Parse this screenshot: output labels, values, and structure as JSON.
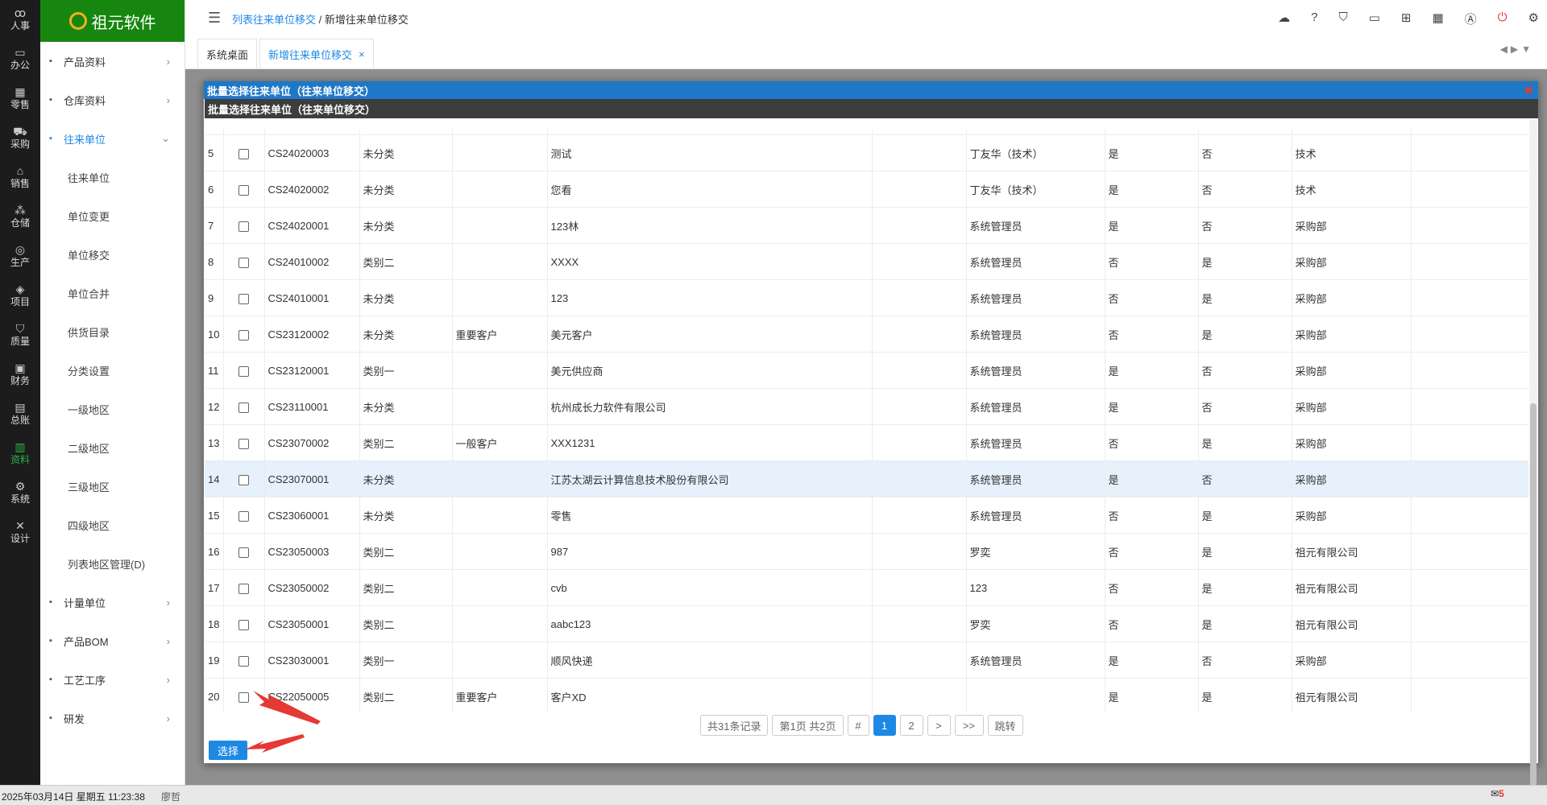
{
  "sidebar_icons": [
    {
      "label": "人事",
      "icon": "people-icon"
    },
    {
      "label": "办公",
      "icon": "monitor-icon"
    },
    {
      "label": "零售",
      "icon": "store-icon"
    },
    {
      "label": "采购",
      "icon": "truck-icon"
    },
    {
      "label": "销售",
      "icon": "cashier-icon"
    },
    {
      "label": "仓储",
      "icon": "boxes-icon"
    },
    {
      "label": "生产",
      "icon": "fingerprint-icon"
    },
    {
      "label": "项目",
      "icon": "layers-icon"
    },
    {
      "label": "质量",
      "icon": "shield-icon"
    },
    {
      "label": "财务",
      "icon": "finance-icon"
    },
    {
      "label": "总账",
      "icon": "ledger-icon"
    },
    {
      "label": "资料",
      "icon": "document-icon"
    },
    {
      "label": "系统",
      "icon": "gear-icon"
    },
    {
      "label": "设计",
      "icon": "tools-icon"
    }
  ],
  "active_icon": "资料",
  "logo_text": "祖元软件",
  "menu": {
    "before": [
      {
        "label": "产品资料",
        "icon": "folder-icon"
      },
      {
        "label": "仓库资料",
        "icon": "warehouse-icon"
      }
    ],
    "open": {
      "label": "往来单位",
      "icon": "building-icon"
    },
    "sub": [
      "往来单位",
      "单位变更",
      "单位移交",
      "单位合并",
      "供货目录",
      "分类设置",
      "一级地区",
      "二级地区",
      "三级地区",
      "四级地区",
      "列表地区管理(D)"
    ],
    "after": [
      {
        "label": "计量单位",
        "icon": "scale-icon"
      },
      {
        "label": "产品BOM",
        "icon": "bom-icon"
      },
      {
        "label": "工艺工序",
        "icon": "process-icon"
      },
      {
        "label": "研发",
        "icon": "chart-icon"
      }
    ]
  },
  "breadcrumb": {
    "link": "列表往来单位移交",
    "sep": "/",
    "current": "新增往来单位移交"
  },
  "tabs": {
    "home": "系统桌面",
    "active": "新增往来单位移交",
    "close": "×"
  },
  "modal": {
    "title": "批量选择往来单位（往来单位移交）",
    "subtitle": "批量选择往来单位（往来单位移交）",
    "rows": [
      {
        "no": "5",
        "code": "CS24020003",
        "cat": "未分类",
        "type": "",
        "name": "测试",
        "blank": "",
        "owner": "丁友华（技术）",
        "c1": "是",
        "c2": "否",
        "dept": "技术"
      },
      {
        "no": "6",
        "code": "CS24020002",
        "cat": "未分类",
        "type": "",
        "name": "您看",
        "blank": "",
        "owner": "丁友华（技术）",
        "c1": "是",
        "c2": "否",
        "dept": "技术"
      },
      {
        "no": "7",
        "code": "CS24020001",
        "cat": "未分类",
        "type": "",
        "name": "123林",
        "blank": "",
        "owner": "系统管理员",
        "c1": "是",
        "c2": "否",
        "dept": "采购部"
      },
      {
        "no": "8",
        "code": "CS24010002",
        "cat": "类别二",
        "type": "",
        "name": "XXXX",
        "blank": "",
        "owner": "系统管理员",
        "c1": "否",
        "c2": "是",
        "dept": "采购部"
      },
      {
        "no": "9",
        "code": "CS24010001",
        "cat": "未分类",
        "type": "",
        "name": "123",
        "blank": "",
        "owner": "系统管理员",
        "c1": "否",
        "c2": "是",
        "dept": "采购部"
      },
      {
        "no": "10",
        "code": "CS23120002",
        "cat": "未分类",
        "type": "重要客户",
        "name": "美元客户",
        "blank": "",
        "owner": "系统管理员",
        "c1": "否",
        "c2": "是",
        "dept": "采购部"
      },
      {
        "no": "11",
        "code": "CS23120001",
        "cat": "类别一",
        "type": "",
        "name": "美元供应商",
        "blank": "",
        "owner": "系统管理员",
        "c1": "是",
        "c2": "否",
        "dept": "采购部"
      },
      {
        "no": "12",
        "code": "CS23110001",
        "cat": "未分类",
        "type": "",
        "name": "杭州成长力软件有限公司",
        "blank": "",
        "owner": "系统管理员",
        "c1": "是",
        "c2": "否",
        "dept": "采购部"
      },
      {
        "no": "13",
        "code": "CS23070002",
        "cat": "类别二",
        "type": "一般客户",
        "name": "XXX1231",
        "blank": "",
        "owner": "系统管理员",
        "c1": "否",
        "c2": "是",
        "dept": "采购部"
      },
      {
        "no": "14",
        "code": "CS23070001",
        "cat": "未分类",
        "type": "",
        "name": "江苏太湖云计算信息技术股份有限公司",
        "blank": "",
        "owner": "系统管理员",
        "c1": "是",
        "c2": "否",
        "dept": "采购部"
      },
      {
        "no": "15",
        "code": "CS23060001",
        "cat": "未分类",
        "type": "",
        "name": "零售",
        "blank": "",
        "owner": "系统管理员",
        "c1": "否",
        "c2": "是",
        "dept": "采购部"
      },
      {
        "no": "16",
        "code": "CS23050003",
        "cat": "类别二",
        "type": "",
        "name": "987",
        "blank": "",
        "owner": "罗奕",
        "c1": "否",
        "c2": "是",
        "dept": "祖元有限公司"
      },
      {
        "no": "17",
        "code": "CS23050002",
        "cat": "类别二",
        "type": "",
        "name": "cvb",
        "blank": "",
        "owner": "123",
        "c1": "否",
        "c2": "是",
        "dept": "祖元有限公司"
      },
      {
        "no": "18",
        "code": "CS23050001",
        "cat": "类别二",
        "type": "",
        "name": "aabc123",
        "blank": "",
        "owner": "罗奕",
        "c1": "否",
        "c2": "是",
        "dept": "祖元有限公司"
      },
      {
        "no": "19",
        "code": "CS23030001",
        "cat": "类别一",
        "type": "",
        "name": "顺风快递",
        "blank": "",
        "owner": "系统管理员",
        "c1": "是",
        "c2": "否",
        "dept": "采购部"
      },
      {
        "no": "20",
        "code": "CS22050005",
        "cat": "类别二",
        "type": "重要客户",
        "name": "客户XD",
        "blank": "",
        "owner": "",
        "c1": "是",
        "c2": "是",
        "dept": "祖元有限公司"
      }
    ],
    "highlighted_row": "14",
    "pager": {
      "total": "共31条记录",
      "page_info": "第1页 共2页",
      "hash": "#",
      "p1": "1",
      "p2": "2",
      "next": ">",
      "last": ">>",
      "jump": "跳转"
    },
    "select_button": "选择"
  },
  "status": {
    "datetime": "2025年03月14日 星期五 11:23:38",
    "user": "廖哲",
    "msg_count": "5"
  }
}
